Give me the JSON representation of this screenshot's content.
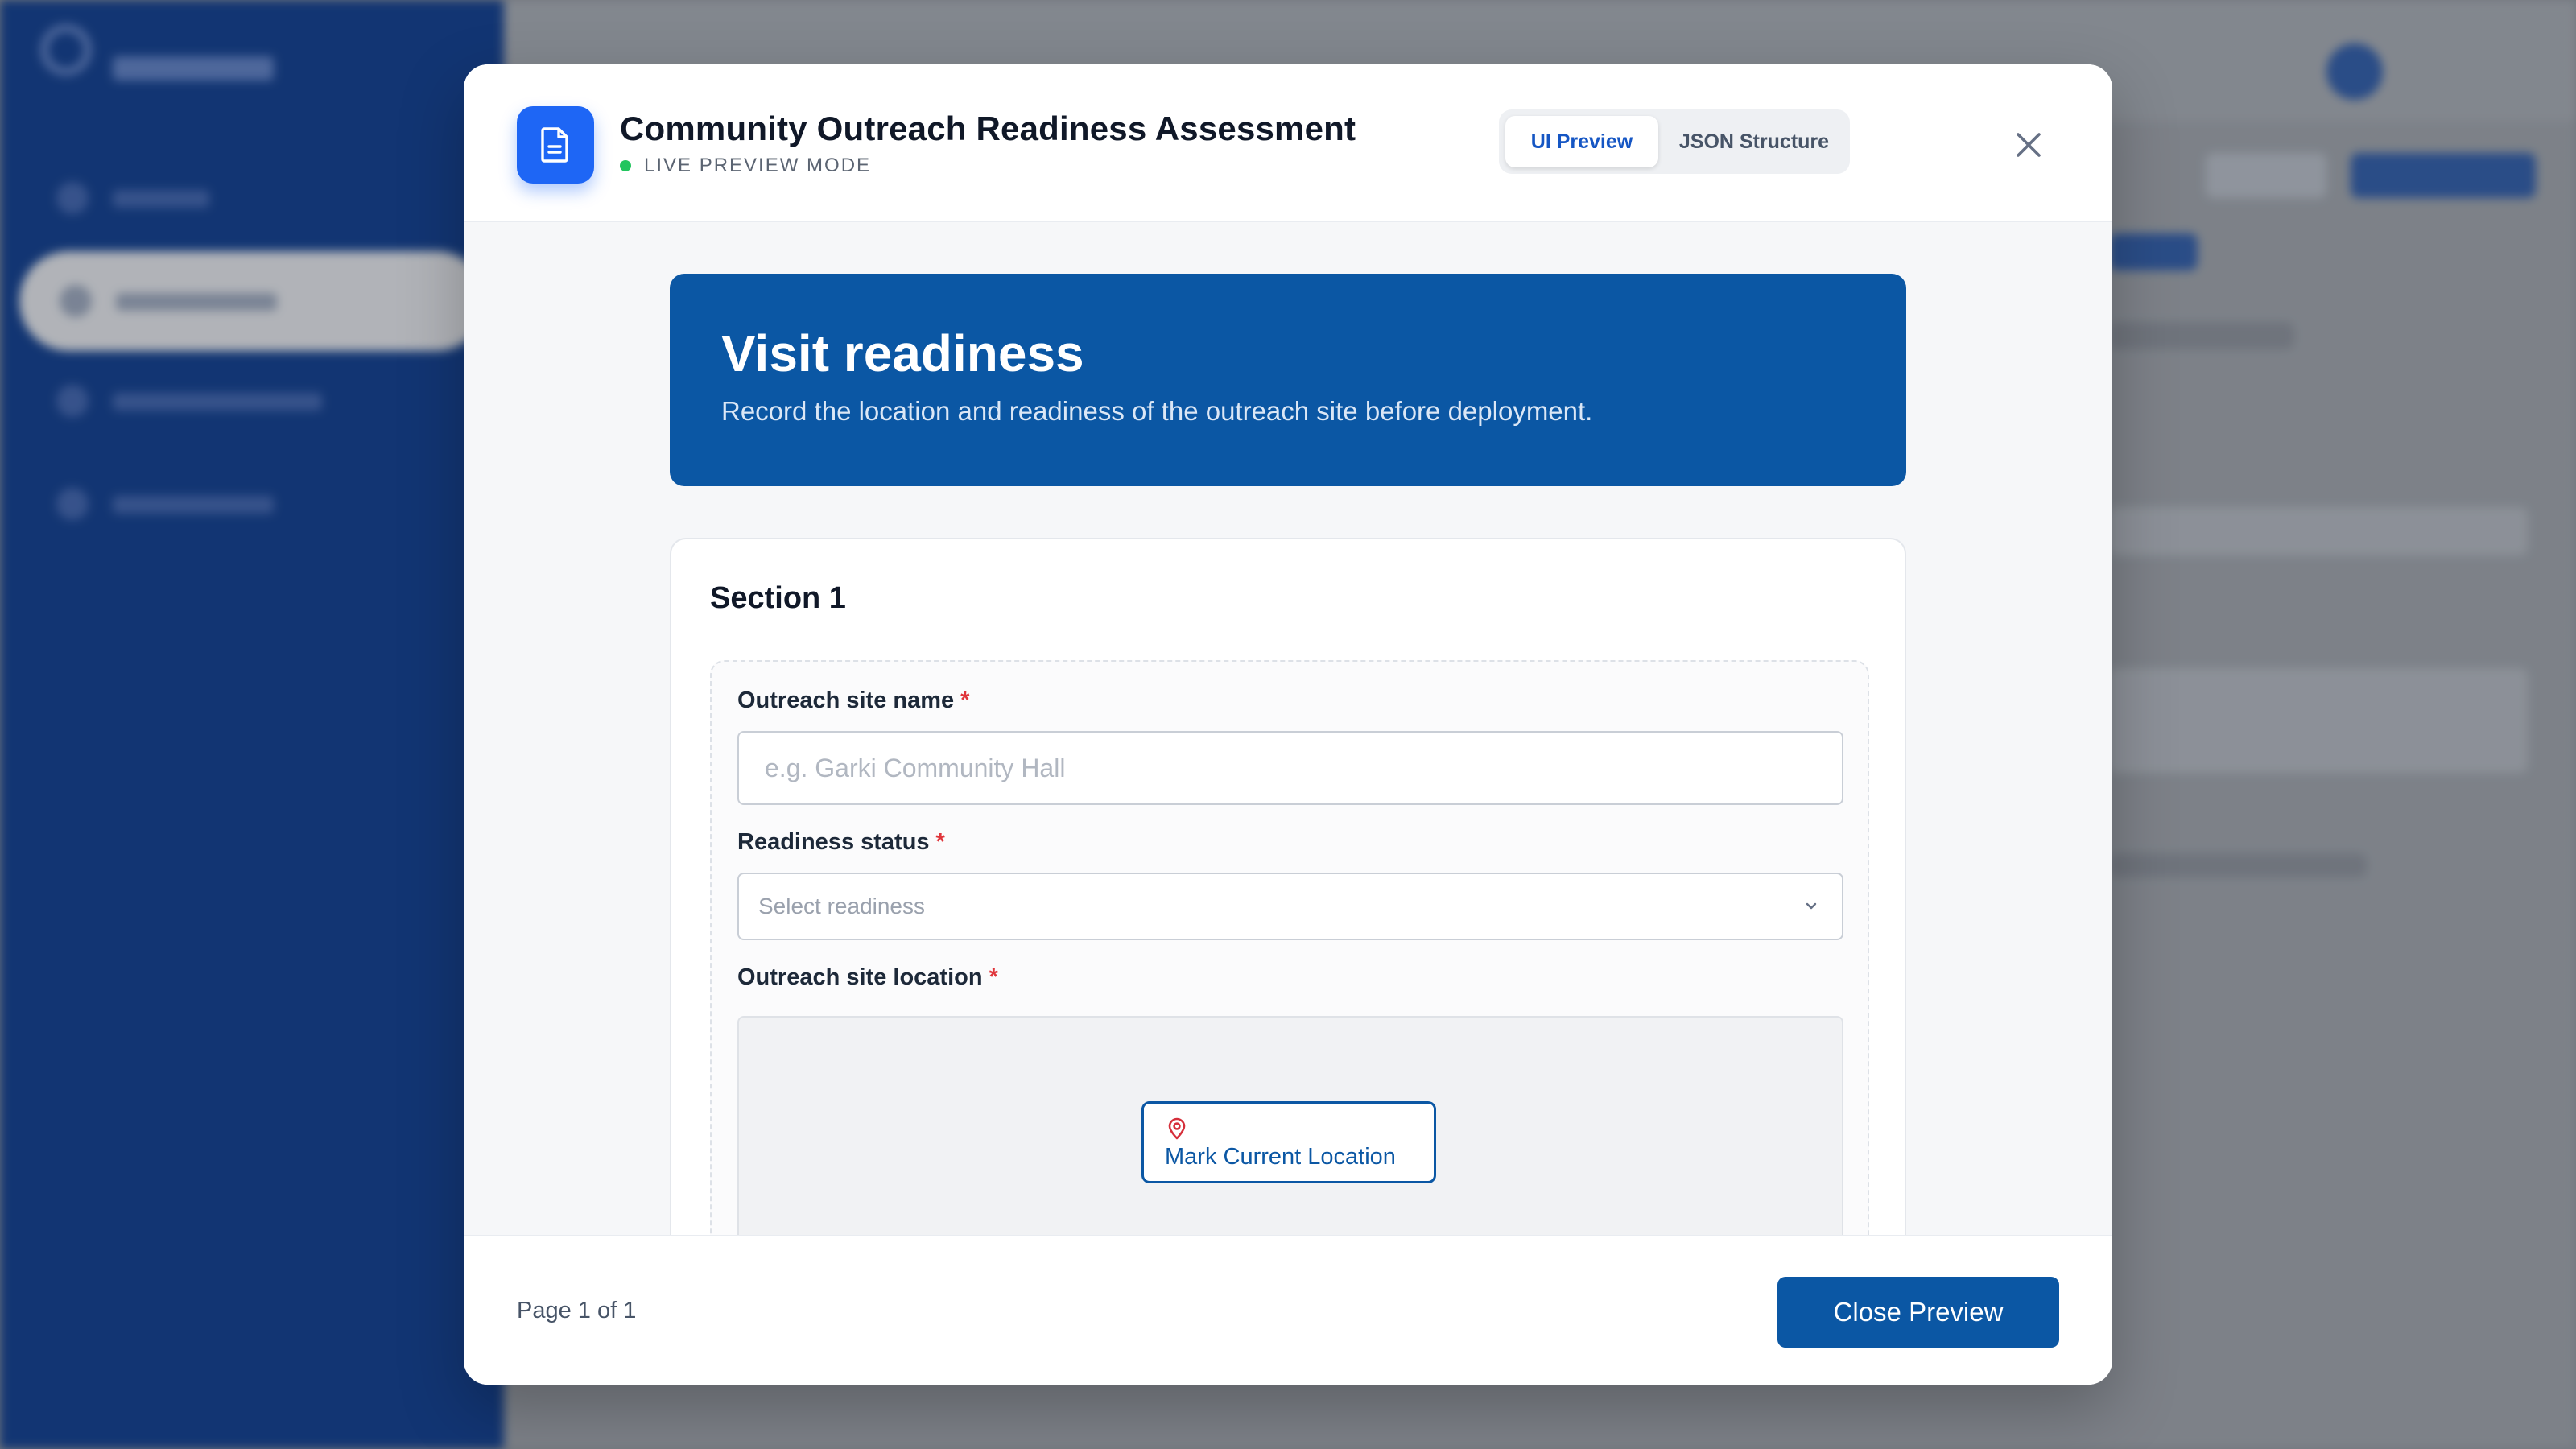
{
  "modal": {
    "title": "Community Outreach Readiness Assessment",
    "mode_label": "LIVE PREVIEW MODE",
    "tabs": [
      {
        "label": "UI Preview",
        "active": true
      },
      {
        "label": "JSON Structure",
        "active": false
      }
    ],
    "icons": {
      "form": "document-icon",
      "close": "close-icon",
      "status": "live-dot-icon"
    }
  },
  "form": {
    "heading": "Visit readiness",
    "description": "Record the location and readiness of the outreach site before deployment.",
    "section_title": "Section 1",
    "fields": [
      {
        "label": "Outreach site name",
        "required_mark": "*",
        "type": "text",
        "value": "",
        "placeholder": "e.g. Garki Community Hall"
      },
      {
        "label": "Readiness status",
        "required_mark": "*",
        "type": "select",
        "value": "Select readiness"
      },
      {
        "label": "Outreach site location",
        "required_mark": "*",
        "type": "location",
        "button_label": "Mark Current Location",
        "button_icon": "map-pin-icon"
      }
    ]
  },
  "footer": {
    "page_indicator": "Page 1 of 1",
    "close_label": "Close Preview"
  },
  "colors": {
    "primary": "#0b57a4",
    "accent": "#1e66f5",
    "required": "#e0353b",
    "live": "#22c55e",
    "sidebar": "#0b3a8c"
  }
}
